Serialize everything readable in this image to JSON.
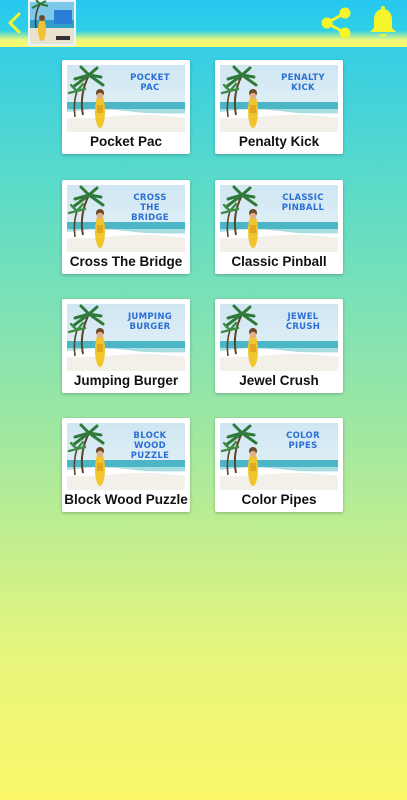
{
  "header": {
    "back_icon": "chevron-left-icon",
    "logo": "app-logo-image",
    "share_icon": "share-icon",
    "bell_icon": "bell-icon",
    "accent_color": "#f5f52a"
  },
  "games": [
    {
      "thumb_text": "POCKET\nPAC",
      "title": "Pocket Pac"
    },
    {
      "thumb_text": "PENALTY\nKICK",
      "title": "Penalty Kick"
    },
    {
      "thumb_text": "CROSS\nTHE\nBRIDGE",
      "title": "Cross The Bridge"
    },
    {
      "thumb_text": "CLASSIC\nPINBALL",
      "title": "Classic Pinball"
    },
    {
      "thumb_text": "JUMPING\nBURGER",
      "title": "Jumping Burger"
    },
    {
      "thumb_text": "JEWEL\nCRUSH",
      "title": "Jewel Crush"
    },
    {
      "thumb_text": "BLOCK\nWOOD\nPUZZLE",
      "title": "Block Wood Puzzle"
    },
    {
      "thumb_text": "COLOR\nPIPES",
      "title": "Color Pipes"
    }
  ]
}
